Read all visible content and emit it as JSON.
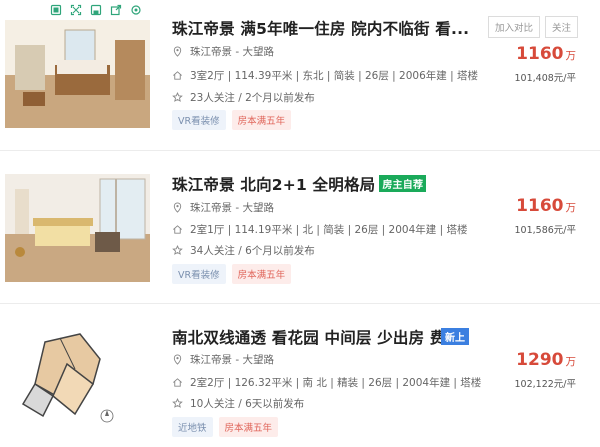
{
  "listings": [
    {
      "title": "珠江帝景 满5年唯一住房 院内不临街 看...",
      "badge": "",
      "location": "珠江帝景 - 大望路",
      "details": "3室2厅 | 114.39平米 | 东北 | 简装 | 26层 | 2006年建 | 塔楼",
      "follow": "23人关注 / 2个月以前发布",
      "chips": [
        "VR看装修",
        "房本满五年"
      ],
      "price": "1160",
      "price_unit": "万",
      "unit_price": "101,408元/平",
      "compare_label": "加入对比",
      "follow_label": "关注"
    },
    {
      "title": "珠江帝景 北向2+1 全明格局",
      "badge": "房主自荐",
      "location": "珠江帝景 - 大望路",
      "details": "2室1厅 | 114.19平米 | 北 | 简装 | 26层 | 2004年建 | 塔楼",
      "follow": "34人关注 / 6个月以前发布",
      "chips": [
        "VR看装修",
        "房本满五年"
      ],
      "price": "1160",
      "price_unit": "万",
      "unit_price": "101,586元/平"
    },
    {
      "title": "南北双线通透 看花园 中间层 少出房 费...",
      "badge": "新上",
      "location": "珠江帝景 - 大望路",
      "details": "2室2厅 | 126.32平米 | 南 北 | 精装 | 26层 | 2004年建 | 塔楼",
      "follow": "10人关注 / 6天以前发布",
      "chips": [
        "近地铁",
        "房本满五年"
      ],
      "price": "1290",
      "price_unit": "万",
      "unit_price": "102,122元/平"
    }
  ],
  "image_tools": [
    "gallery-icon",
    "fullscreen-icon",
    "save-icon",
    "share-icon",
    "settings-icon"
  ],
  "colors": {
    "price": "#d74a3a",
    "green_badge": "#1aaa5a",
    "blue_badge": "#3b7fe0",
    "chip_pink_text": "#e0655a",
    "chip_blue_text": "#7a8fae"
  }
}
